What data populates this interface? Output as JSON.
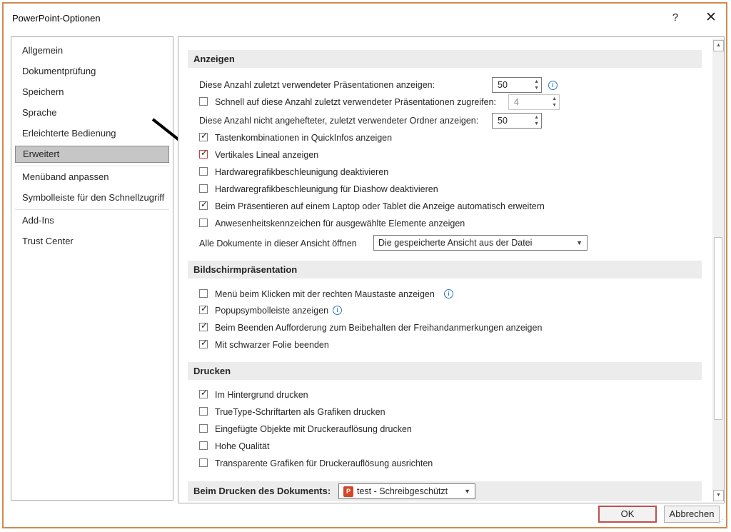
{
  "window": {
    "title": "PowerPoint-Optionen",
    "help_glyph": "?",
    "close_glyph": "✕"
  },
  "nav": {
    "items": [
      {
        "label": "Allgemein"
      },
      {
        "label": "Dokumentprüfung"
      },
      {
        "label": "Speichern"
      },
      {
        "label": "Sprache"
      },
      {
        "label": "Erleichterte Bedienung"
      },
      {
        "label": "Erweitert",
        "selected": true
      },
      {
        "label": "Menüband anpassen"
      },
      {
        "label": "Symbolleiste für den Schnellzugriff"
      },
      {
        "label": "Add-Ins"
      },
      {
        "label": "Trust Center"
      }
    ]
  },
  "sections": {
    "anzeigen": {
      "header": "Anzeigen",
      "recent_presentations_label": "Diese Anzahl zuletzt verwendeter Präsentationen anzeigen:",
      "recent_presentations_value": "50",
      "quick_access_label": "Schnell auf diese Anzahl zuletzt verwendeter Präsentationen zugreifen:",
      "quick_access_value": "4",
      "quick_access_checked": false,
      "unpinned_folders_label": "Diese Anzahl nicht angehefteter, zuletzt verwendeter Ordner anzeigen:",
      "unpinned_folders_value": "50",
      "checkboxes": [
        {
          "label": "Tastenkombinationen in QuickInfos anzeigen",
          "checked": true
        },
        {
          "label": "Vertikales Lineal anzeigen",
          "checked": true
        },
        {
          "label": "Hardwaregrafikbeschleunigung deaktivieren",
          "checked": false
        },
        {
          "label": "Hardwaregrafikbeschleunigung für Diashow deaktivieren",
          "checked": false
        },
        {
          "label": "Beim Präsentieren auf einem Laptop oder Tablet die Anzeige automatisch erweitern",
          "checked": true
        },
        {
          "label": "Anwesenheitskennzeichen für ausgewählte Elemente anzeigen",
          "checked": false
        }
      ],
      "open_all_label": "Alle Dokumente in dieser Ansicht öffnen",
      "open_all_value": "Die gespeicherte Ansicht aus der Datei"
    },
    "bildschirm": {
      "header": "Bildschirmpräsentation",
      "checkboxes": [
        {
          "label": "Menü beim Klicken mit der rechten Maustaste anzeigen",
          "checked": false
        },
        {
          "label": "Popupsymbolleiste anzeigen",
          "checked": true
        },
        {
          "label": "Beim Beenden Aufforderung zum Beibehalten der Freihandanmerkungen anzeigen",
          "checked": true
        },
        {
          "label": "Mit schwarzer Folie beenden",
          "checked": true
        }
      ]
    },
    "drucken": {
      "header": "Drucken",
      "checkboxes": [
        {
          "label": "Im Hintergrund drucken",
          "checked": true
        },
        {
          "label": "TrueType-Schriftarten als Grafiken drucken",
          "checked": false
        },
        {
          "label": "Eingefügte Objekte mit Druckerauflösung drucken",
          "checked": false
        },
        {
          "label": "Hohe Qualität",
          "checked": false
        },
        {
          "label": "Transparente Grafiken für Druckerauflösung ausrichten",
          "checked": false
        }
      ]
    },
    "beim_drucken": {
      "header": "Beim Drucken des Dokuments:",
      "document_value": "test  -  Schreibgeschützt"
    }
  },
  "footer": {
    "ok_label": "OK",
    "cancel_label": "Abbrechen"
  },
  "icons": {
    "info": "info-icon",
    "checkmark": "✓",
    "annotation": "arrow-annotation"
  }
}
